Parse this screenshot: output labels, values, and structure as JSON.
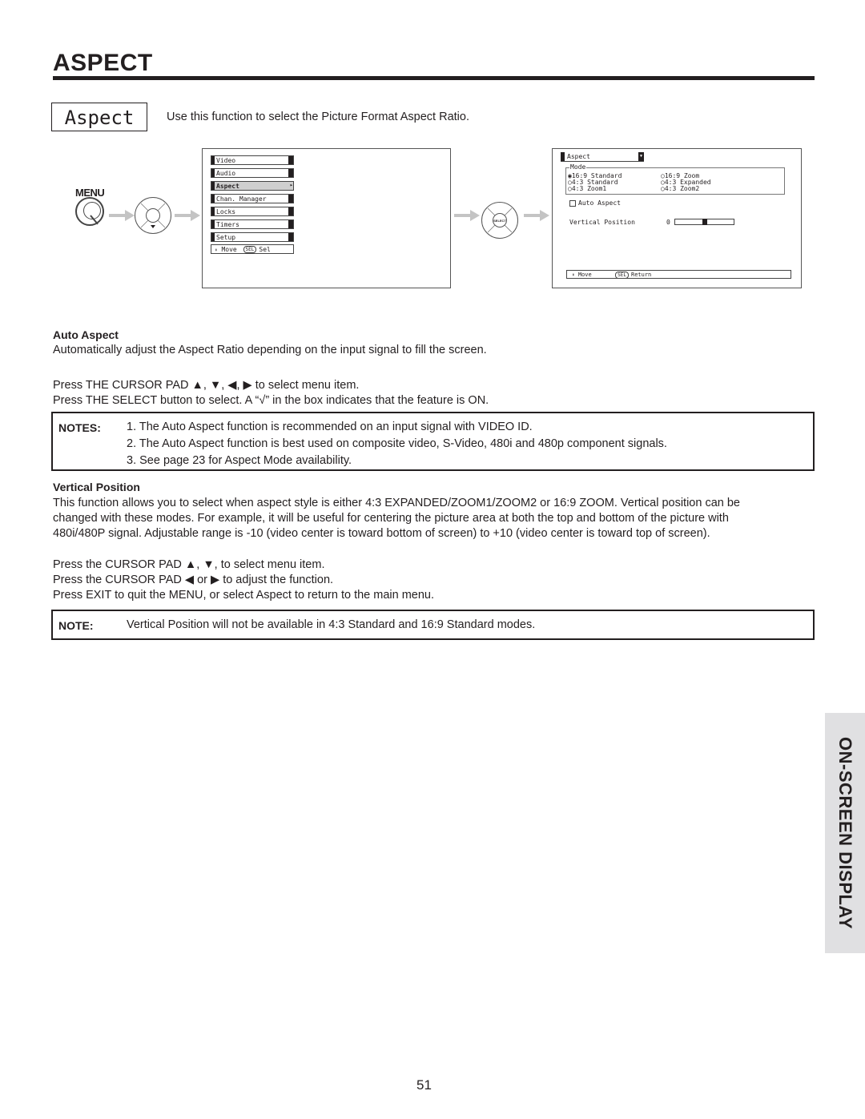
{
  "header": {
    "title": "ASPECT",
    "function_label": "Aspect",
    "intro": "Use this function to select the Picture Format Aspect Ratio."
  },
  "diagram": {
    "menu_button_label": "MENU",
    "select_button_label": "SELECT",
    "main_menu": {
      "items": [
        {
          "label": "Video",
          "selected": false
        },
        {
          "label": "Audio",
          "selected": false
        },
        {
          "label": "Aspect",
          "selected": true
        },
        {
          "label": "Chan. Manager",
          "selected": false
        },
        {
          "label": "Locks",
          "selected": false
        },
        {
          "label": "Timers",
          "selected": false
        },
        {
          "label": "Setup",
          "selected": false
        }
      ],
      "footer": {
        "move": "Move",
        "sel_badge": "SEL",
        "action": "Sel"
      }
    },
    "aspect_menu": {
      "title": "Aspect",
      "mode_group_label": "Mode",
      "modes": [
        {
          "label": "16:9 Standard",
          "selected": true
        },
        {
          "label": "16:9 Zoom",
          "selected": false
        },
        {
          "label": "4:3 Standard",
          "selected": false
        },
        {
          "label": "4:3 Expanded",
          "selected": false
        },
        {
          "label": "4:3 Zoom1",
          "selected": false
        },
        {
          "label": "4:3 Zoom2",
          "selected": false
        }
      ],
      "auto_aspect_label": "Auto Aspect",
      "auto_aspect_checked": false,
      "vertical_position_label": "Vertical Position",
      "vertical_position_value": "0",
      "vertical_position_range": [
        -10,
        10
      ],
      "footer": {
        "move": "Move",
        "sel_badge": "SEL",
        "action": "Return"
      }
    }
  },
  "auto_aspect": {
    "heading": "Auto Aspect",
    "description": "Automatically adjust the Aspect Ratio depending on the input signal to fill the screen.",
    "instructions": [
      "Press THE CURSOR PAD ▲, ▼, ◀, ▶ to select menu item.",
      "Press THE SELECT button to select.  A “√” in the box indicates that the feature is ON."
    ],
    "notes_label": "NOTES:",
    "notes": [
      "1. The Auto Aspect function is recommended on an input signal with VIDEO ID.",
      "2. The Auto Aspect function is best used on composite video, S-Video, 480i and 480p component signals.",
      "3. See page 23 for Aspect Mode availability."
    ]
  },
  "vertical_position": {
    "heading": "Vertical Position",
    "description_lines": [
      "This function allows you to select when aspect style is either 4:3 EXPANDED/ZOOM1/ZOOM2 or 16:9 ZOOM.  Vertical position can be",
      "changed with these modes.  For example, it will be useful for centering the picture area at both the top and bottom of the picture with",
      "480i/480P signal.  Adjustable range is -10 (video center is toward bottom of screen) to +10 (video center is toward top of screen)."
    ],
    "instructions": [
      "Press the CURSOR PAD ▲, ▼, to select menu item.",
      "Press the CURSOR PAD  ◀ or ▶ to adjust the function.",
      "Press EXIT to quit the MENU, or select Aspect to return to the main menu."
    ],
    "note_label": "NOTE:",
    "note": "Vertical Position will not be available in 4:3 Standard and 16:9 Standard modes."
  },
  "side_tab": "ON-SCREEN DISPLAY",
  "page_number": "51"
}
